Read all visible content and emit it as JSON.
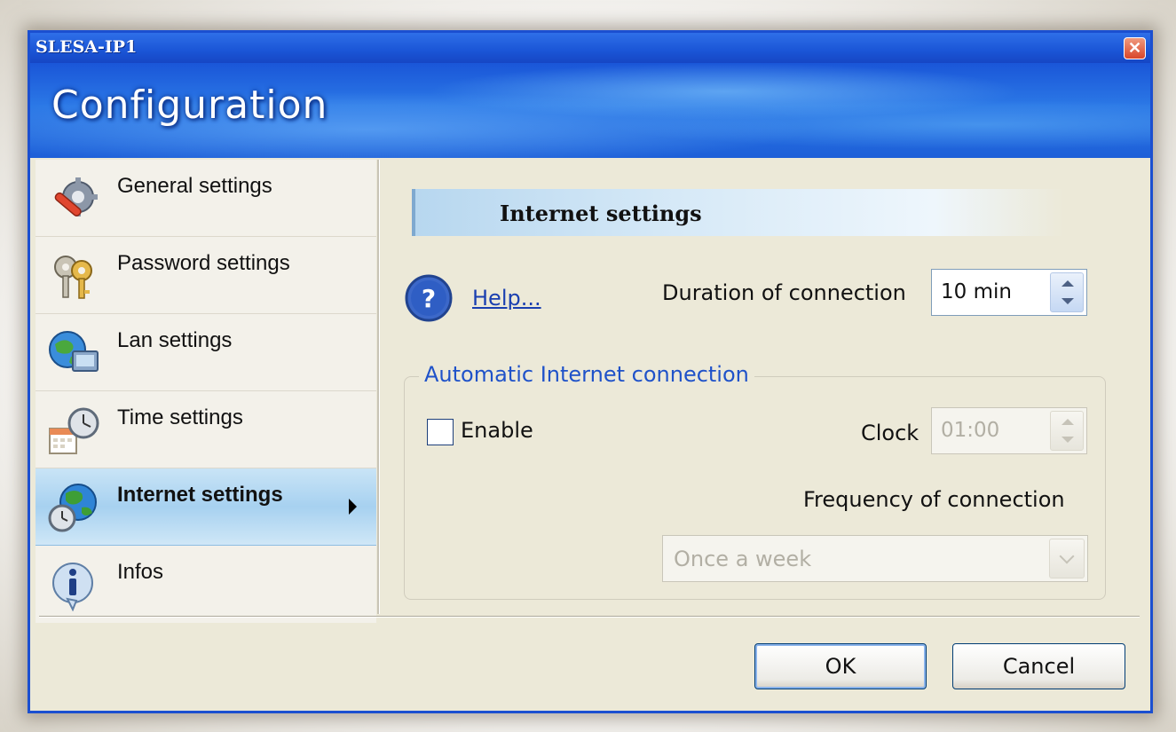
{
  "window": {
    "title": "SLESA-IP1",
    "close_label": "✕"
  },
  "banner": {
    "title": "Configuration"
  },
  "sidebar": {
    "items": [
      {
        "label": "General settings",
        "icon": "tools-icon",
        "active": false
      },
      {
        "label": "Password settings",
        "icon": "keys-icon",
        "active": false
      },
      {
        "label": "Lan settings",
        "icon": "network-globe-icon",
        "active": false
      },
      {
        "label": "Time settings",
        "icon": "clock-calendar-icon",
        "active": false
      },
      {
        "label": "Internet settings",
        "icon": "globe-clock-icon",
        "active": true
      },
      {
        "label": "Infos",
        "icon": "info-icon",
        "active": false
      }
    ]
  },
  "main": {
    "section_title": "Internet settings",
    "help": {
      "icon": "help-icon",
      "label": "Help..."
    },
    "duration": {
      "label": "Duration of connection",
      "value": "10 min"
    },
    "auto_group": {
      "legend": "Automatic Internet connection",
      "enable_label": "Enable",
      "enable_checked": false,
      "clock": {
        "label": "Clock",
        "value": "01:00",
        "disabled": true
      },
      "frequency": {
        "label": "Frequency of connection",
        "value": "Once a week",
        "disabled": true
      }
    }
  },
  "footer": {
    "ok_label": "OK",
    "cancel_label": "Cancel"
  },
  "colors": {
    "titlebar": "#1a55d6",
    "active_nav": "#a7d1f0",
    "group_legend": "#1f52c9"
  }
}
